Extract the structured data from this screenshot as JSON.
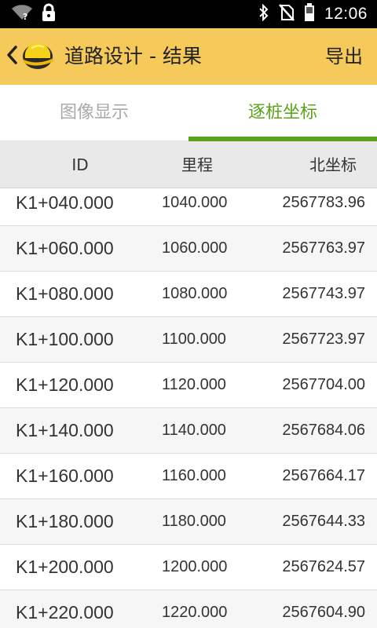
{
  "status_bar": {
    "time": "12:06",
    "icons": [
      "wifi-unknown-icon",
      "lock-icon",
      "bluetooth-icon",
      "no-sim-icon",
      "battery-icon"
    ]
  },
  "app_bar": {
    "title": "道路设计 - 结果",
    "export_label": "导出",
    "back_icon": "chevron-left-icon",
    "logo_icon": "hard-hat-icon"
  },
  "tabs": [
    {
      "label": "图像显示",
      "selected": false
    },
    {
      "label": "逐桩坐标",
      "selected": true
    }
  ],
  "table": {
    "columns": [
      "ID",
      "里程",
      "北坐标"
    ],
    "rows": [
      {
        "id": "K1+040.000",
        "mileage": "1040.000",
        "north": "2567783.96"
      },
      {
        "id": "K1+060.000",
        "mileage": "1060.000",
        "north": "2567763.97"
      },
      {
        "id": "K1+080.000",
        "mileage": "1080.000",
        "north": "2567743.97"
      },
      {
        "id": "K1+100.000",
        "mileage": "1100.000",
        "north": "2567723.97"
      },
      {
        "id": "K1+120.000",
        "mileage": "1120.000",
        "north": "2567704.00"
      },
      {
        "id": "K1+140.000",
        "mileage": "1140.000",
        "north": "2567684.06"
      },
      {
        "id": "K1+160.000",
        "mileage": "1160.000",
        "north": "2567664.17"
      },
      {
        "id": "K1+180.000",
        "mileage": "1180.000",
        "north": "2567644.33"
      },
      {
        "id": "K1+200.000",
        "mileage": "1200.000",
        "north": "2567624.57"
      },
      {
        "id": "K1+220.000",
        "mileage": "1220.000",
        "north": "2567604.90"
      }
    ]
  },
  "colors": {
    "app_bar": "#f5c95a",
    "tab_active": "#5aa31a",
    "tab_inactive": "#a9a9a9",
    "header_bg": "#e9e9e9"
  }
}
